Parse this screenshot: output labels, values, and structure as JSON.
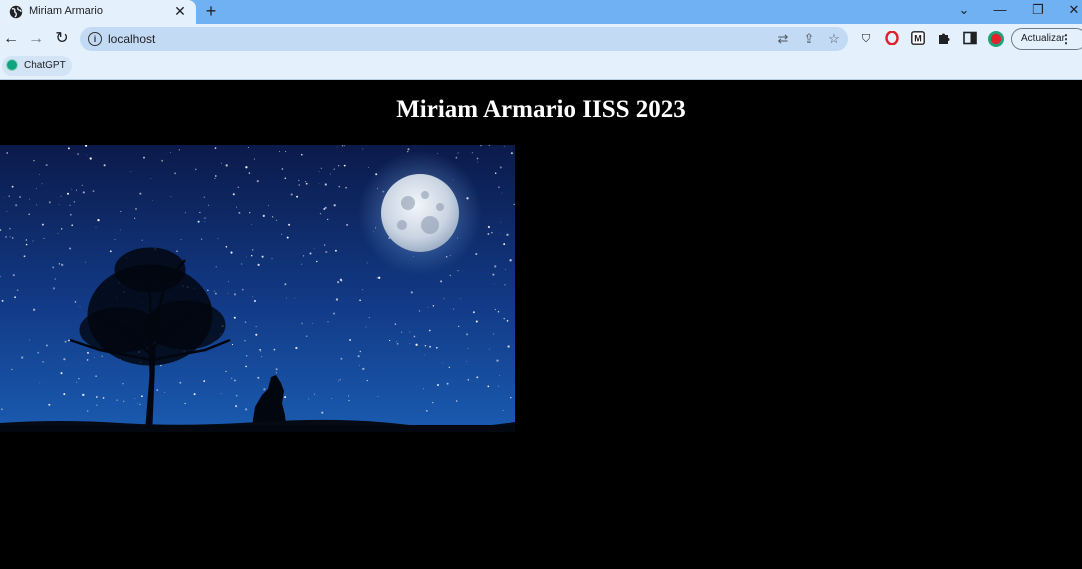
{
  "browser": {
    "tab_title": "Miriam Armario",
    "url": "localhost",
    "update_label": "Actualizar",
    "bookmarks": [
      {
        "label": "ChatGPT"
      }
    ],
    "extension_icons": [
      "shield-icon",
      "opera-icon",
      "m-extension-icon",
      "puzzle-extensions-icon",
      "side-panel-icon",
      "profile-avatar"
    ]
  },
  "page": {
    "heading": "Miriam Armario IISS 2023",
    "image_description_name": "night-sky-wolf-moon-image",
    "background_color": "#000000"
  },
  "colors": {
    "tabbar": "#6fb1f2",
    "chrome": "#e4f0fc",
    "omnibox": "#c2daf4",
    "sky_top": "#0b1a4a",
    "sky_bottom": "#1a5bb0"
  }
}
